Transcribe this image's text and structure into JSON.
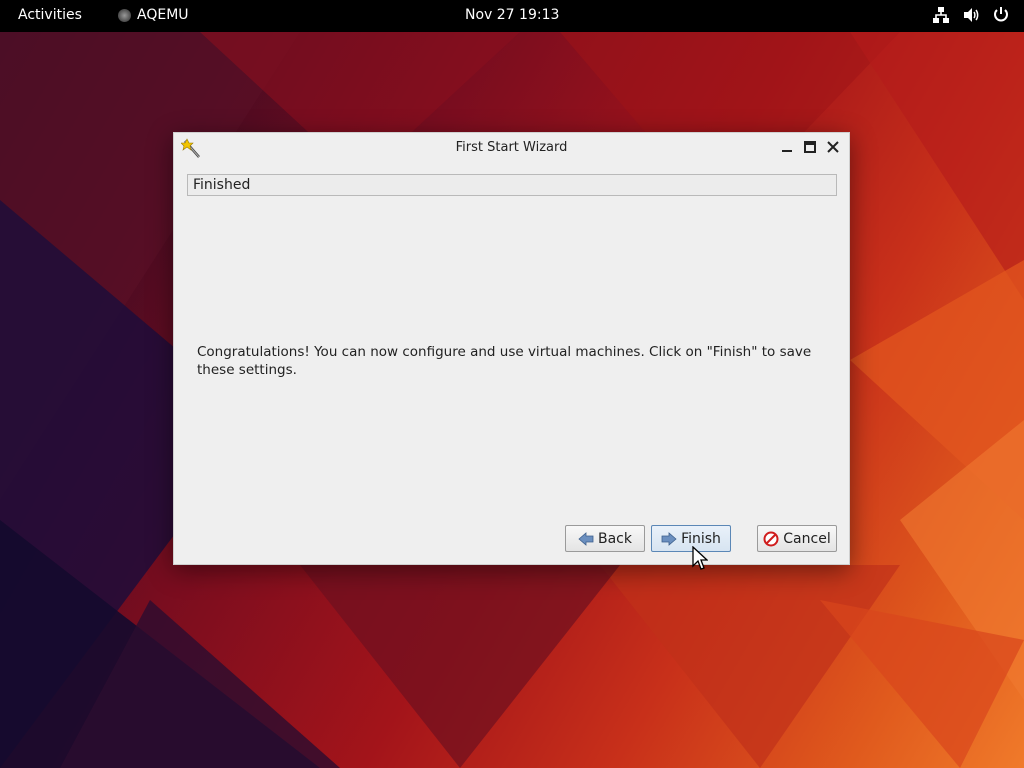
{
  "topbar": {
    "activities": "Activities",
    "app_name": "AQEMU",
    "clock": "Nov 27  19:13",
    "tray_icons": [
      "network-icon",
      "volume-icon",
      "power-icon"
    ]
  },
  "dialog": {
    "title": "First Start Wizard",
    "page_header": "Finished",
    "message": "Congratulations! You can now configure and use virtual machines. Click on \"Finish\" to save these settings.",
    "buttons": {
      "back": "Back",
      "finish": "Finish",
      "cancel": "Cancel"
    }
  },
  "colors": {
    "topbar_bg": "#000000",
    "dialog_bg": "#efefef",
    "finish_accent": "#5b87b6",
    "cancel_icon": "#d01c1c"
  }
}
